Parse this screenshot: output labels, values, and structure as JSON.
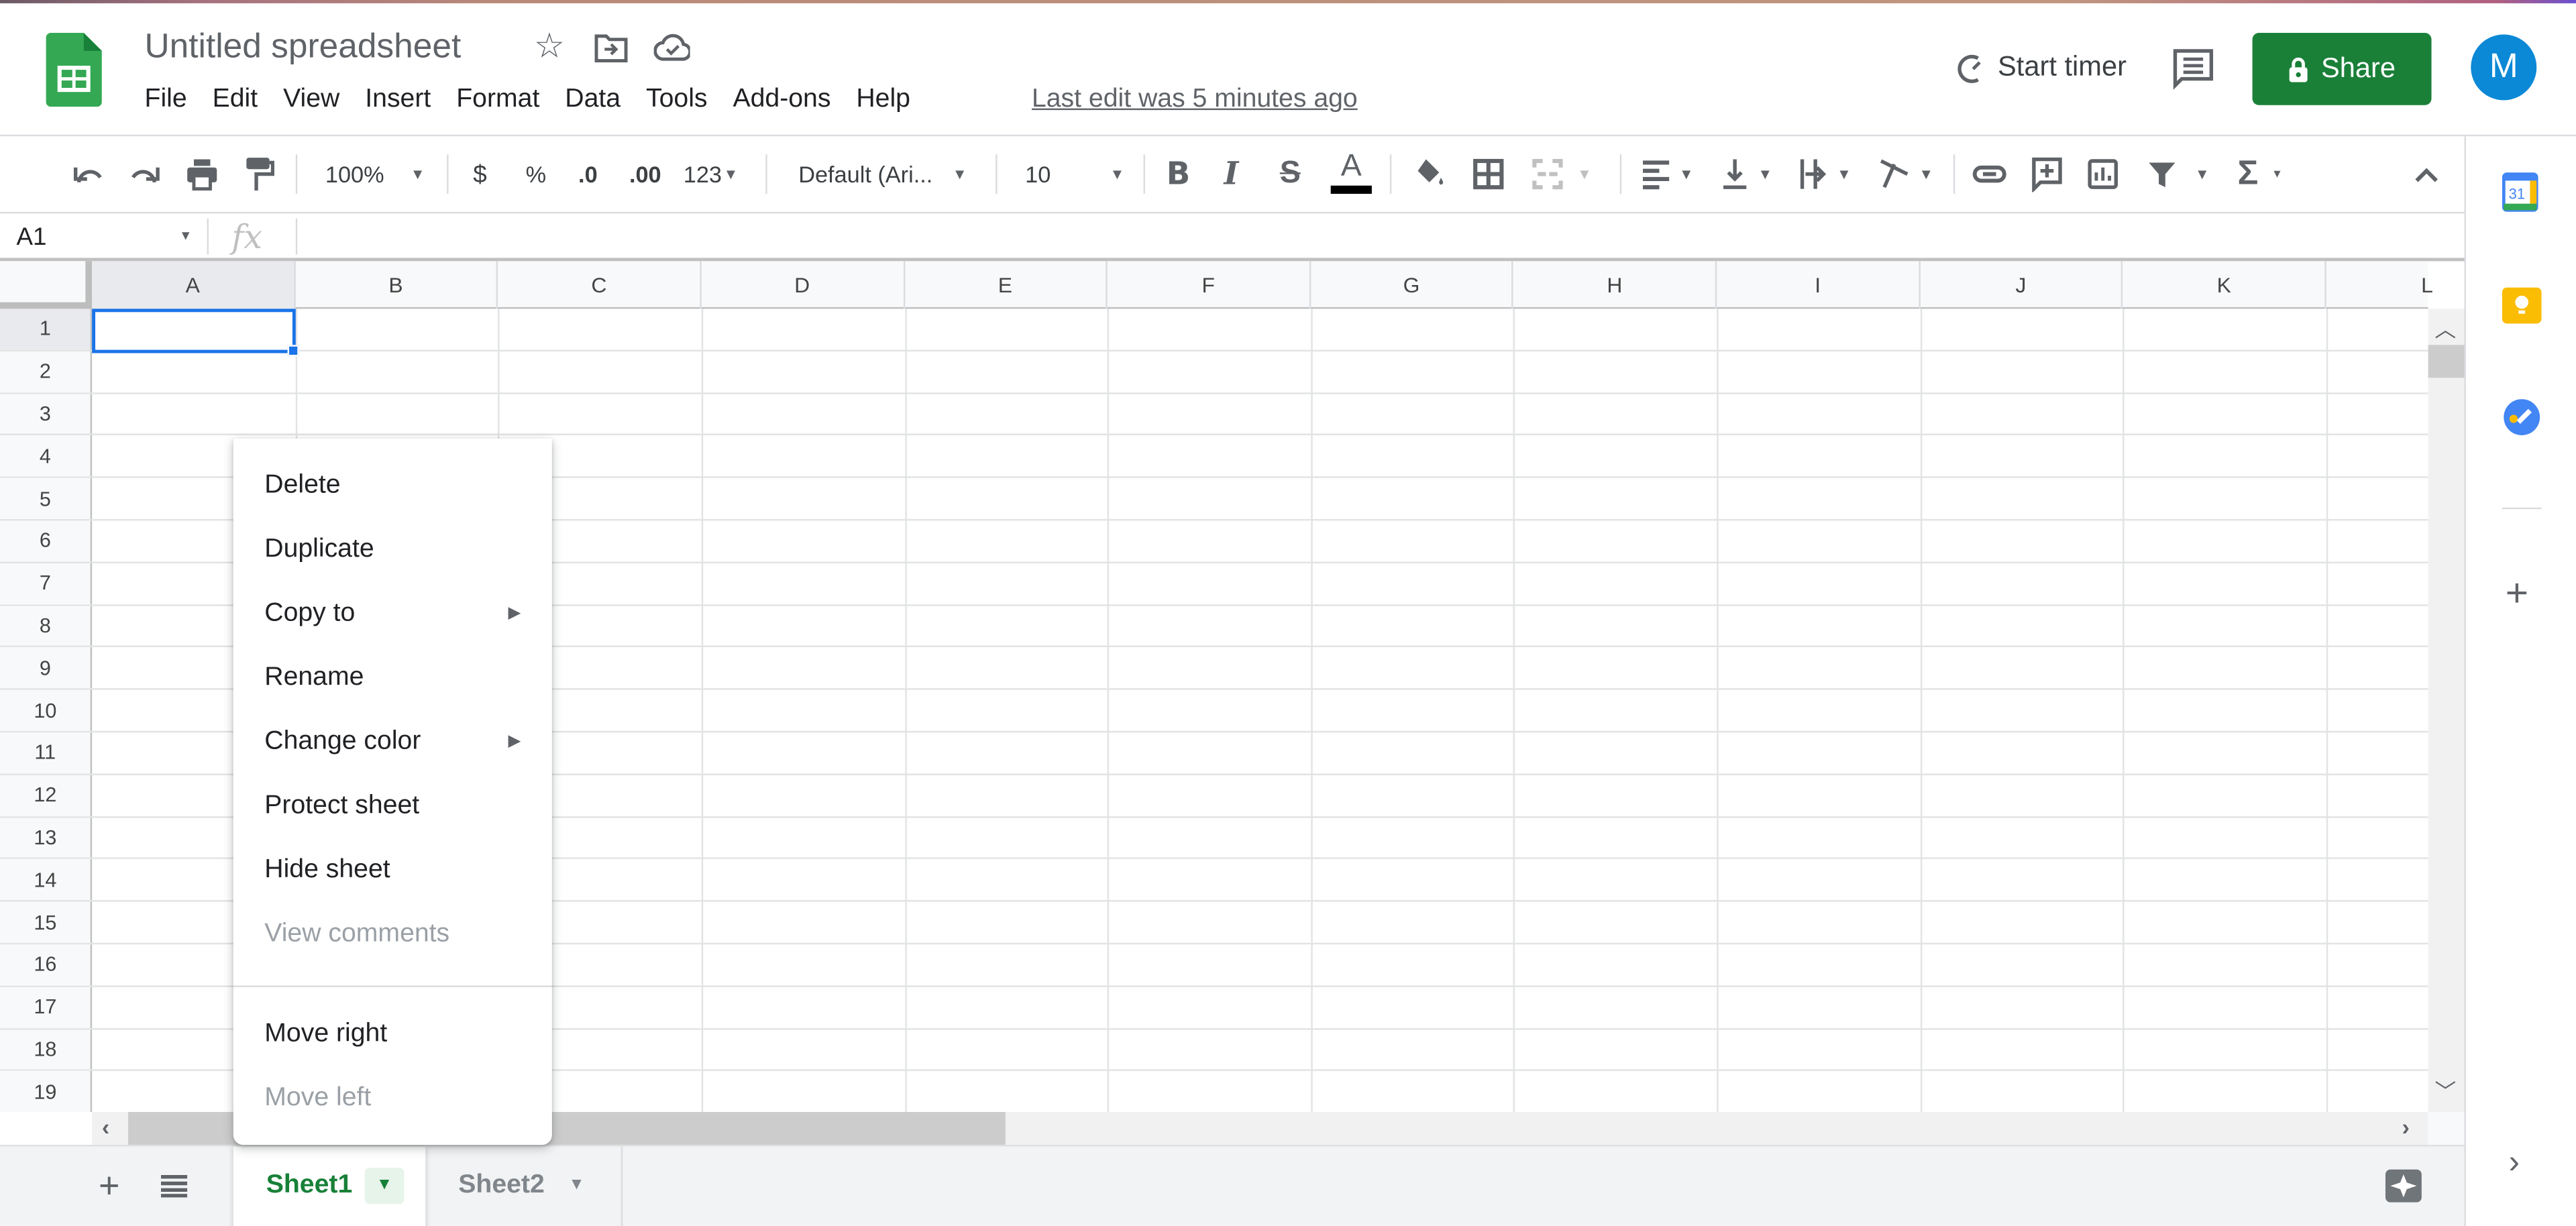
{
  "header": {
    "title": "Untitled spreadsheet",
    "menu": [
      "File",
      "Edit",
      "View",
      "Insert",
      "Format",
      "Data",
      "Tools",
      "Add-ons",
      "Help"
    ],
    "last_edit": "Last edit was 5 minutes ago",
    "start_timer": "Start timer",
    "share_label": "Share",
    "avatar_initial": "M",
    "colors": {
      "share": "#1a8038",
      "avatar": "#0b88d6",
      "sheets_logo": "#34a853"
    }
  },
  "toolbar": {
    "zoom": "100%",
    "currency": "$",
    "percent": "%",
    "decrease_decimal": ".0",
    "increase_decimal": ".00",
    "more_formats": "123",
    "font": "Default (Ari...",
    "font_size": "10",
    "bold": "B",
    "italic": "I",
    "strikethrough": "S",
    "text_color": "A",
    "sum": "Σ"
  },
  "formula_bar": {
    "name_box": "A1",
    "fx": "fx",
    "value": ""
  },
  "grid": {
    "columns": [
      "A",
      "B",
      "C",
      "D",
      "E",
      "F",
      "G",
      "H",
      "I",
      "J",
      "K",
      "L"
    ],
    "rows": [
      "1",
      "2",
      "3",
      "4",
      "5",
      "6",
      "7",
      "8",
      "9",
      "10",
      "11",
      "12",
      "13",
      "14",
      "15",
      "16",
      "17",
      "18",
      "19"
    ],
    "selected_cell": "A1"
  },
  "context_menu": {
    "items": [
      {
        "label": "Delete",
        "disabled": false
      },
      {
        "label": "Duplicate",
        "disabled": false
      },
      {
        "label": "Copy to",
        "disabled": false,
        "submenu": true
      },
      {
        "label": "Rename",
        "disabled": false
      },
      {
        "label": "Change color",
        "disabled": false,
        "submenu": true
      },
      {
        "label": "Protect sheet",
        "disabled": false
      },
      {
        "label": "Hide sheet",
        "disabled": false
      },
      {
        "label": "View comments",
        "disabled": true
      },
      {
        "label": "Move right",
        "disabled": false
      },
      {
        "label": "Move left",
        "disabled": true
      }
    ]
  },
  "sheets": {
    "tabs": [
      {
        "label": "Sheet1",
        "active": true
      },
      {
        "label": "Sheet2",
        "active": false
      }
    ]
  }
}
